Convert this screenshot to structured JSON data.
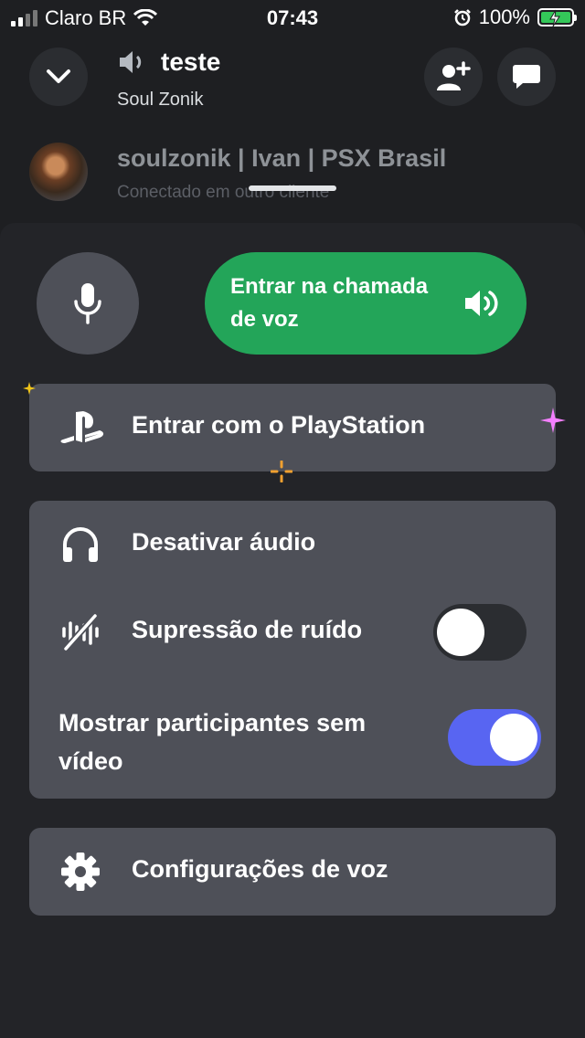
{
  "status_bar": {
    "carrier": "Claro BR",
    "time": "07:43",
    "battery": "100%",
    "icons": [
      "signal-icon",
      "wifi-icon",
      "alarm-icon",
      "battery-charging-icon"
    ]
  },
  "header": {
    "channel_name": "teste",
    "server_name": "Soul Zonik",
    "icons": [
      "chevron-down-icon",
      "speaker-icon",
      "add-user-icon",
      "chat-icon"
    ]
  },
  "participant": {
    "name": "soulzonik | Ivan | PSX Brasil",
    "status": "Conectado em outro cliente"
  },
  "controls": {
    "join_voice_label": "Entrar na chamada de voz",
    "accent_green": "#23a559"
  },
  "playstation": {
    "label": "Entrar com o PlayStation"
  },
  "settings_card": {
    "deafen_label": "Desativar áudio",
    "noise_suppression_label": "Supressão de ruído",
    "noise_suppression_on": false,
    "show_no_video_label": "Mostrar participantes sem vídeo",
    "show_no_video_on": true,
    "toggle_on_color": "#5865f2"
  },
  "voice_settings": {
    "label": "Configurações de voz"
  }
}
